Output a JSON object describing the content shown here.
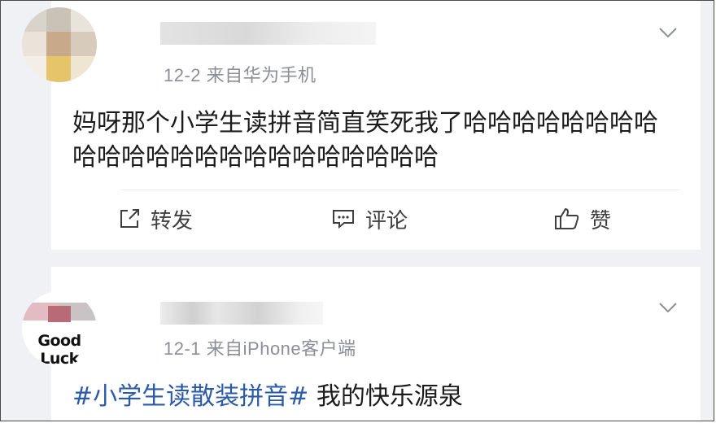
{
  "posts": [
    {
      "meta": "12-2  来自华为手机",
      "content": "妈呀那个小学生读拼音简直笑死我了哈哈哈哈哈哈哈哈哈哈哈哈哈哈哈哈哈哈哈哈哈哈哈",
      "actions": {
        "repost": "转发",
        "comment": "评论",
        "like": "赞"
      },
      "icons": [
        "share-icon",
        "comment-icon",
        "thumbs-up-icon",
        "chevron-down-icon"
      ]
    },
    {
      "meta": "12-1  来自iPhone客户端",
      "avatar_text": "Good Luck",
      "hashtag": "#小学生读散装拼音#",
      "content_rest": " 我的快乐源泉",
      "icons": [
        "chevron-down-icon"
      ]
    }
  ],
  "colors": {
    "link": "#2a5aa8",
    "meta": "#8a8f99",
    "background": "#eff1f4"
  }
}
